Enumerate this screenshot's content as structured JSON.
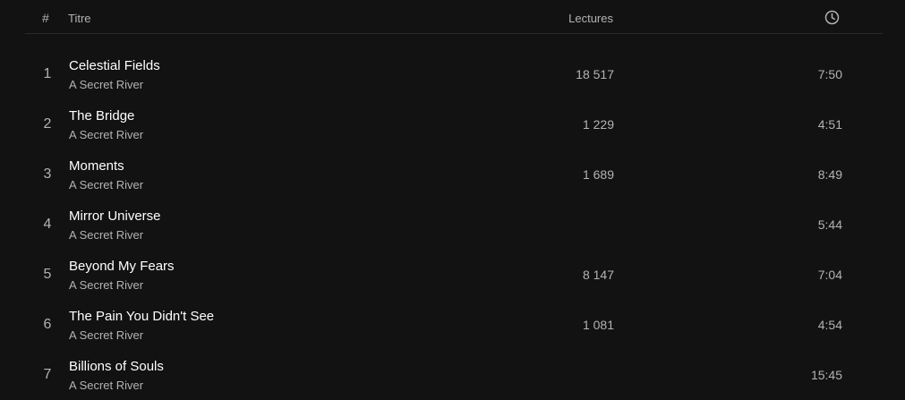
{
  "header": {
    "number_label": "#",
    "title_label": "Titre",
    "plays_label": "Lectures",
    "duration_icon": "clock-icon"
  },
  "colors": {
    "background": "#121212",
    "primary_text": "#ffffff",
    "secondary_text": "#b3b3b3",
    "divider": "#2a2a2a"
  },
  "tracks": [
    {
      "number": "1",
      "title": "Celestial Fields",
      "artist": "A Secret River",
      "plays": "18 517",
      "duration": "7:50"
    },
    {
      "number": "2",
      "title": "The Bridge",
      "artist": "A Secret River",
      "plays": "1 229",
      "duration": "4:51"
    },
    {
      "number": "3",
      "title": "Moments",
      "artist": "A Secret River",
      "plays": "1 689",
      "duration": "8:49"
    },
    {
      "number": "4",
      "title": "Mirror Universe",
      "artist": "A Secret River",
      "plays": "",
      "duration": "5:44"
    },
    {
      "number": "5",
      "title": "Beyond My Fears",
      "artist": "A Secret River",
      "plays": "8 147",
      "duration": "7:04"
    },
    {
      "number": "6",
      "title": "The Pain You Didn't See",
      "artist": "A Secret River",
      "plays": "1 081",
      "duration": "4:54"
    },
    {
      "number": "7",
      "title": "Billions of Souls",
      "artist": "A Secret River",
      "plays": "",
      "duration": "15:45"
    }
  ]
}
